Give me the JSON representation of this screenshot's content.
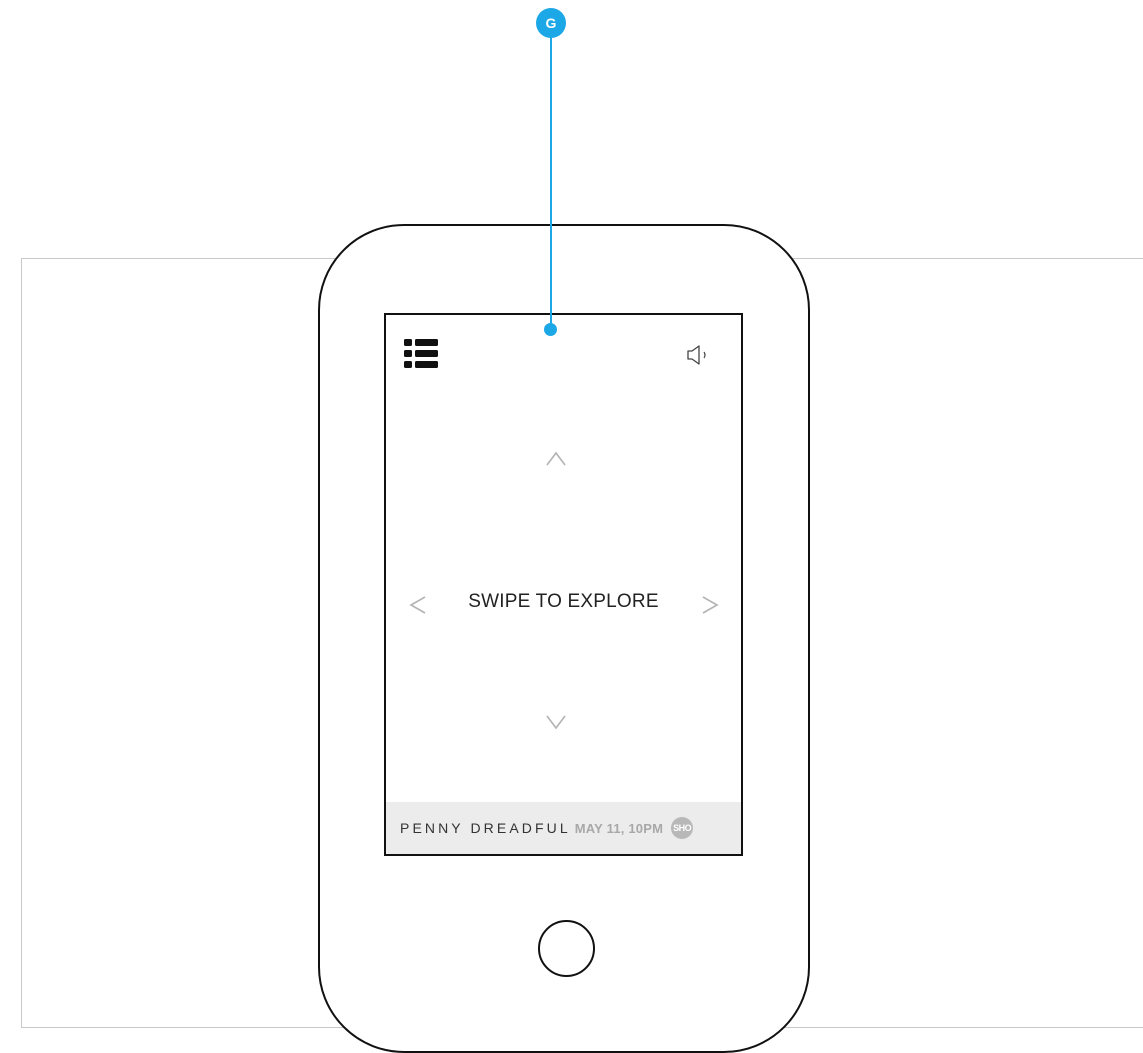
{
  "callout": {
    "label": "G",
    "color": "#1ca8e6"
  },
  "device": {
    "home_button": "home-button"
  },
  "screen": {
    "menu_icon": "list-menu-icon",
    "speaker_icon": "speaker-icon",
    "arrows": {
      "up": "chevron-up-icon",
      "down": "chevron-down-icon",
      "left": "chevron-left-icon",
      "right": "chevron-right-icon"
    },
    "prompt": "SWIPE TO EXPLORE"
  },
  "banner": {
    "title": "PENNY DREADFUL",
    "date": "MAY 11, 10PM",
    "logo_text": "SHO",
    "background": "#ececec"
  }
}
